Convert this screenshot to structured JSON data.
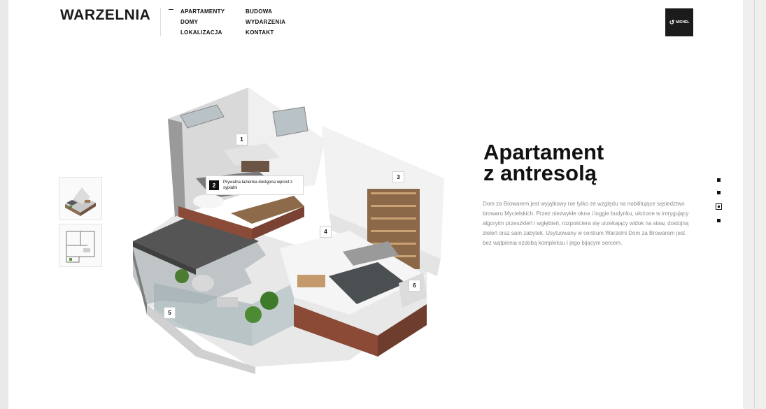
{
  "brand": {
    "logo": "WARZELNIA"
  },
  "nav": {
    "col1": [
      "APARTAMENTY",
      "DOMY",
      "LOKALIZACJA"
    ],
    "col2": [
      "BUDOWA",
      "WYDARZENIA",
      "KONTAKT"
    ]
  },
  "badge": {
    "label": "MICHEL"
  },
  "thumbnails": [
    {
      "name": "3d-view"
    },
    {
      "name": "floor-plan"
    }
  ],
  "markers": [
    "1",
    "3",
    "4",
    "5",
    "6"
  ],
  "tooltip": {
    "number": "2",
    "text": "Prywatna łazienka dostępna wprost z sypialni"
  },
  "content": {
    "title_line1": "Apartament",
    "title_line2": "z antresolą",
    "description": "Dom za Browarem jest wyjątkowy nie tylko ze względu na nobilitujące sąsiedztwo browaru Mycielskich. Przez niezwykłe okna i loggie budynku, ułożone w intrygujący algorytm przeszkleń i wgłębień, rozpościera się urzekający widok na staw, dostojną zieleń oraz sam zabytek. Usytuowany w centrum Warzelni Dom za Browarem jest bez wątpienia ozdobą kompleksu i jego bijącym sercem."
  },
  "pager": {
    "count": 4,
    "active": 3
  }
}
